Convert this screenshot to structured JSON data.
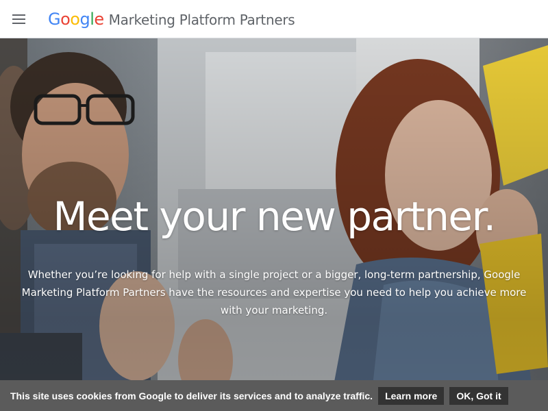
{
  "header": {
    "logo_letters": [
      {
        "char": "G",
        "color": "#4285F4"
      },
      {
        "char": "o",
        "color": "#EA4335"
      },
      {
        "char": "o",
        "color": "#FBBC05"
      },
      {
        "char": "g",
        "color": "#4285F4"
      },
      {
        "char": "l",
        "color": "#34A853"
      },
      {
        "char": "e",
        "color": "#EA4335"
      }
    ],
    "title": "Marketing Platform Partners",
    "menu_icon": "hamburger-menu-icon"
  },
  "hero": {
    "title": "Meet your new partner.",
    "description": "Whether you’re looking for help with a single project or a bigger, long-term partnership, Google Marketing Platform Partners have the resources and expertise you need to help you achieve more with your marketing."
  },
  "cookie_bar": {
    "text": "This site uses cookies from Google to deliver its services and to analyze traffic.",
    "learn_more_label": "Learn more",
    "ok_label": "OK, Got it"
  },
  "colors": {
    "header_bg": "#ffffff",
    "title_gray": "#5f6368",
    "cookie_bar_bg": "#5b5b5b",
    "cookie_button_bg": "#333333",
    "sticky_note_yellow": "#f2d33a"
  }
}
